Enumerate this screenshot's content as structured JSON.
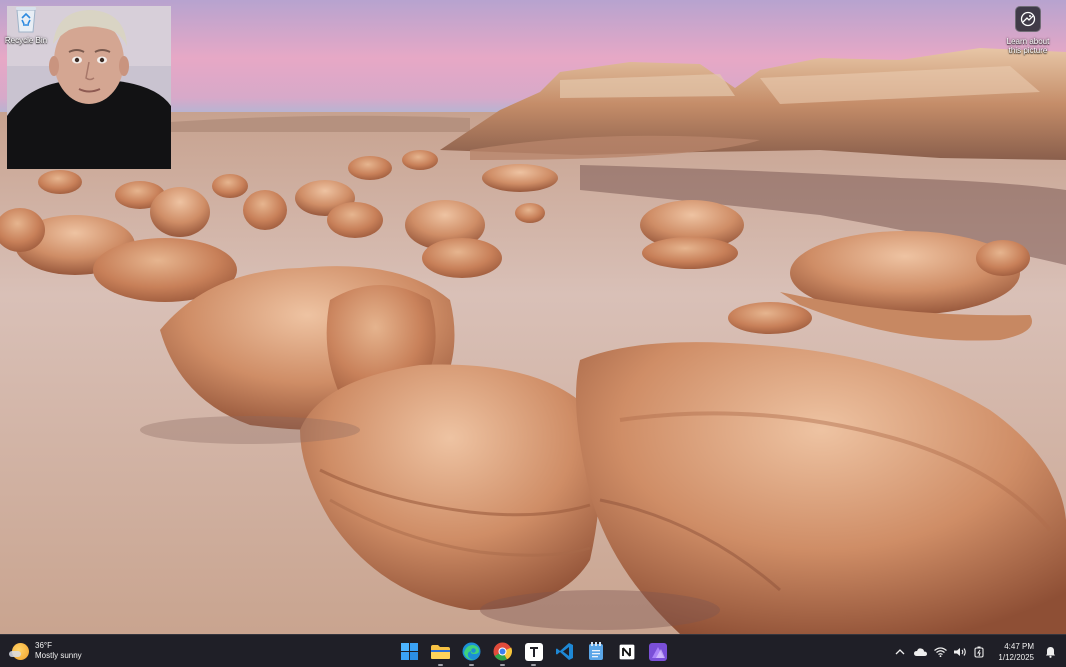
{
  "desktop": {
    "icons": [
      {
        "label": "Recycle Bin",
        "icon": "recycle-bin-icon"
      },
      {
        "label": "Learn about this picture",
        "icon": "learn-about-picture-icon"
      }
    ]
  },
  "taskbar": {
    "weather": {
      "temperature": "36°F",
      "condition": "Mostly sunny",
      "icon": "sun-icon"
    },
    "apps": [
      {
        "name": "Start",
        "icon": "windows-start-icon",
        "color": "#3ea3ff"
      },
      {
        "name": "File Explorer",
        "icon": "folder-icon",
        "color": "#f7c244"
      },
      {
        "name": "Microsoft Edge",
        "icon": "edge-icon",
        "color": "#2c9fe6"
      },
      {
        "name": "Google Chrome",
        "icon": "chrome-icon",
        "color": "#e14b3b"
      },
      {
        "name": "Typora",
        "icon": "typora-icon",
        "color": "#ffffff"
      },
      {
        "name": "Visual Studio Code",
        "icon": "vscode-icon",
        "color": "#1e88d6"
      },
      {
        "name": "Notepad",
        "icon": "notepad-icon",
        "color": "#5aa6e8"
      },
      {
        "name": "Notion",
        "icon": "notion-icon",
        "color": "#ffffff"
      },
      {
        "name": "Affinity",
        "icon": "affinity-icon",
        "color": "#8f5ae8"
      }
    ],
    "tray": {
      "icons": [
        "chevron-up-icon",
        "onedrive-cloud-icon",
        "wifi-icon",
        "speaker-icon",
        "battery-icon"
      ],
      "time": "4:47 PM",
      "date": "1/12/2025",
      "notification_icon": "bell-icon"
    }
  }
}
